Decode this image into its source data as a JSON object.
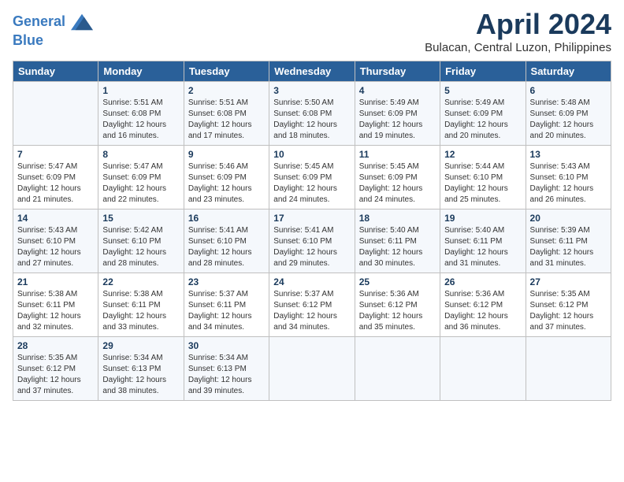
{
  "header": {
    "logo_line1": "General",
    "logo_line2": "Blue",
    "month_title": "April 2024",
    "location": "Bulacan, Central Luzon, Philippines"
  },
  "weekdays": [
    "Sunday",
    "Monday",
    "Tuesday",
    "Wednesday",
    "Thursday",
    "Friday",
    "Saturday"
  ],
  "weeks": [
    [
      {
        "day": "",
        "sunrise": "",
        "sunset": "",
        "daylight": ""
      },
      {
        "day": "1",
        "sunrise": "Sunrise: 5:51 AM",
        "sunset": "Sunset: 6:08 PM",
        "daylight": "Daylight: 12 hours and 16 minutes."
      },
      {
        "day": "2",
        "sunrise": "Sunrise: 5:51 AM",
        "sunset": "Sunset: 6:08 PM",
        "daylight": "Daylight: 12 hours and 17 minutes."
      },
      {
        "day": "3",
        "sunrise": "Sunrise: 5:50 AM",
        "sunset": "Sunset: 6:08 PM",
        "daylight": "Daylight: 12 hours and 18 minutes."
      },
      {
        "day": "4",
        "sunrise": "Sunrise: 5:49 AM",
        "sunset": "Sunset: 6:09 PM",
        "daylight": "Daylight: 12 hours and 19 minutes."
      },
      {
        "day": "5",
        "sunrise": "Sunrise: 5:49 AM",
        "sunset": "Sunset: 6:09 PM",
        "daylight": "Daylight: 12 hours and 20 minutes."
      },
      {
        "day": "6",
        "sunrise": "Sunrise: 5:48 AM",
        "sunset": "Sunset: 6:09 PM",
        "daylight": "Daylight: 12 hours and 20 minutes."
      }
    ],
    [
      {
        "day": "7",
        "sunrise": "Sunrise: 5:47 AM",
        "sunset": "Sunset: 6:09 PM",
        "daylight": "Daylight: 12 hours and 21 minutes."
      },
      {
        "day": "8",
        "sunrise": "Sunrise: 5:47 AM",
        "sunset": "Sunset: 6:09 PM",
        "daylight": "Daylight: 12 hours and 22 minutes."
      },
      {
        "day": "9",
        "sunrise": "Sunrise: 5:46 AM",
        "sunset": "Sunset: 6:09 PM",
        "daylight": "Daylight: 12 hours and 23 minutes."
      },
      {
        "day": "10",
        "sunrise": "Sunrise: 5:45 AM",
        "sunset": "Sunset: 6:09 PM",
        "daylight": "Daylight: 12 hours and 24 minutes."
      },
      {
        "day": "11",
        "sunrise": "Sunrise: 5:45 AM",
        "sunset": "Sunset: 6:09 PM",
        "daylight": "Daylight: 12 hours and 24 minutes."
      },
      {
        "day": "12",
        "sunrise": "Sunrise: 5:44 AM",
        "sunset": "Sunset: 6:10 PM",
        "daylight": "Daylight: 12 hours and 25 minutes."
      },
      {
        "day": "13",
        "sunrise": "Sunrise: 5:43 AM",
        "sunset": "Sunset: 6:10 PM",
        "daylight": "Daylight: 12 hours and 26 minutes."
      }
    ],
    [
      {
        "day": "14",
        "sunrise": "Sunrise: 5:43 AM",
        "sunset": "Sunset: 6:10 PM",
        "daylight": "Daylight: 12 hours and 27 minutes."
      },
      {
        "day": "15",
        "sunrise": "Sunrise: 5:42 AM",
        "sunset": "Sunset: 6:10 PM",
        "daylight": "Daylight: 12 hours and 28 minutes."
      },
      {
        "day": "16",
        "sunrise": "Sunrise: 5:41 AM",
        "sunset": "Sunset: 6:10 PM",
        "daylight": "Daylight: 12 hours and 28 minutes."
      },
      {
        "day": "17",
        "sunrise": "Sunrise: 5:41 AM",
        "sunset": "Sunset: 6:10 PM",
        "daylight": "Daylight: 12 hours and 29 minutes."
      },
      {
        "day": "18",
        "sunrise": "Sunrise: 5:40 AM",
        "sunset": "Sunset: 6:11 PM",
        "daylight": "Daylight: 12 hours and 30 minutes."
      },
      {
        "day": "19",
        "sunrise": "Sunrise: 5:40 AM",
        "sunset": "Sunset: 6:11 PM",
        "daylight": "Daylight: 12 hours and 31 minutes."
      },
      {
        "day": "20",
        "sunrise": "Sunrise: 5:39 AM",
        "sunset": "Sunset: 6:11 PM",
        "daylight": "Daylight: 12 hours and 31 minutes."
      }
    ],
    [
      {
        "day": "21",
        "sunrise": "Sunrise: 5:38 AM",
        "sunset": "Sunset: 6:11 PM",
        "daylight": "Daylight: 12 hours and 32 minutes."
      },
      {
        "day": "22",
        "sunrise": "Sunrise: 5:38 AM",
        "sunset": "Sunset: 6:11 PM",
        "daylight": "Daylight: 12 hours and 33 minutes."
      },
      {
        "day": "23",
        "sunrise": "Sunrise: 5:37 AM",
        "sunset": "Sunset: 6:11 PM",
        "daylight": "Daylight: 12 hours and 34 minutes."
      },
      {
        "day": "24",
        "sunrise": "Sunrise: 5:37 AM",
        "sunset": "Sunset: 6:12 PM",
        "daylight": "Daylight: 12 hours and 34 minutes."
      },
      {
        "day": "25",
        "sunrise": "Sunrise: 5:36 AM",
        "sunset": "Sunset: 6:12 PM",
        "daylight": "Daylight: 12 hours and 35 minutes."
      },
      {
        "day": "26",
        "sunrise": "Sunrise: 5:36 AM",
        "sunset": "Sunset: 6:12 PM",
        "daylight": "Daylight: 12 hours and 36 minutes."
      },
      {
        "day": "27",
        "sunrise": "Sunrise: 5:35 AM",
        "sunset": "Sunset: 6:12 PM",
        "daylight": "Daylight: 12 hours and 37 minutes."
      }
    ],
    [
      {
        "day": "28",
        "sunrise": "Sunrise: 5:35 AM",
        "sunset": "Sunset: 6:12 PM",
        "daylight": "Daylight: 12 hours and 37 minutes."
      },
      {
        "day": "29",
        "sunrise": "Sunrise: 5:34 AM",
        "sunset": "Sunset: 6:13 PM",
        "daylight": "Daylight: 12 hours and 38 minutes."
      },
      {
        "day": "30",
        "sunrise": "Sunrise: 5:34 AM",
        "sunset": "Sunset: 6:13 PM",
        "daylight": "Daylight: 12 hours and 39 minutes."
      },
      {
        "day": "",
        "sunrise": "",
        "sunset": "",
        "daylight": ""
      },
      {
        "day": "",
        "sunrise": "",
        "sunset": "",
        "daylight": ""
      },
      {
        "day": "",
        "sunrise": "",
        "sunset": "",
        "daylight": ""
      },
      {
        "day": "",
        "sunrise": "",
        "sunset": "",
        "daylight": ""
      }
    ]
  ]
}
